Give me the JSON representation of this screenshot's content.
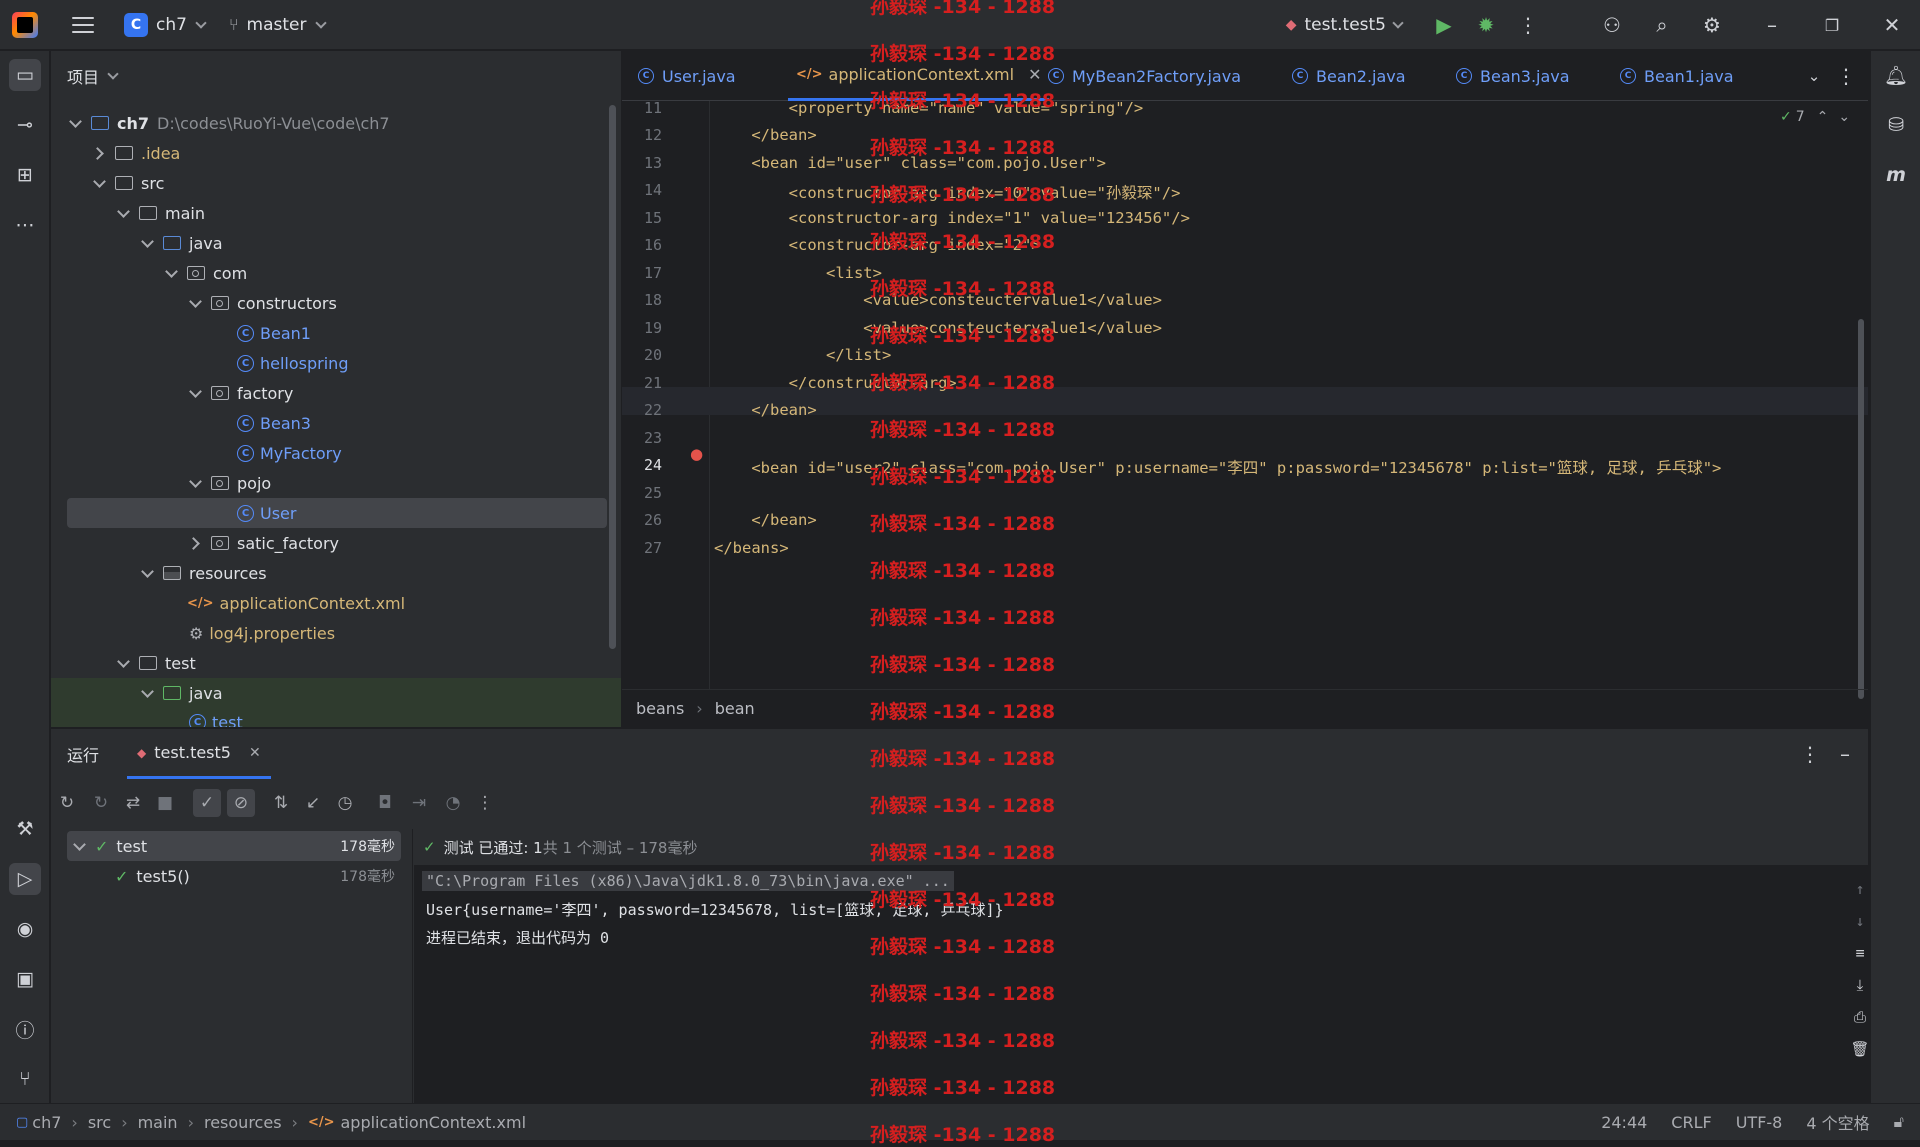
{
  "titlebar": {
    "project_name": "ch7",
    "project_badge": "C",
    "branch": "master",
    "run_config": "test.test5"
  },
  "project_panel": {
    "title": "项目",
    "tree": [
      {
        "label": "ch7",
        "detail": "D:\\codes\\RuoYi-Vue\\code\\ch7"
      },
      {
        "label": ".idea"
      },
      {
        "label": "src"
      },
      {
        "label": "main"
      },
      {
        "label": "java"
      },
      {
        "label": "com"
      },
      {
        "label": "constructors"
      },
      {
        "label": "Bean1"
      },
      {
        "label": "hellospring"
      },
      {
        "label": "factory"
      },
      {
        "label": "Bean3"
      },
      {
        "label": "MyFactory"
      },
      {
        "label": "pojo"
      },
      {
        "label": "User"
      },
      {
        "label": "satic_factory"
      },
      {
        "label": "resources"
      },
      {
        "label": "applicationContext.xml"
      },
      {
        "label": "log4j.properties"
      },
      {
        "label": "test"
      },
      {
        "label": "java"
      },
      {
        "label": "test"
      }
    ]
  },
  "editor": {
    "tabs": [
      {
        "label": "User.java"
      },
      {
        "label": "applicationContext.xml"
      },
      {
        "label": "MyBean2Factory.java"
      },
      {
        "label": "Bean2.java"
      },
      {
        "label": "Bean3.java"
      },
      {
        "label": "Bean1.java"
      }
    ],
    "inspection_count": "7",
    "line_numbers": [
      "11",
      "12",
      "13",
      "14",
      "15",
      "16",
      "17",
      "18",
      "19",
      "20",
      "21",
      "22",
      "23",
      "24",
      "25",
      "26",
      "27"
    ],
    "lines": [
      "        <property name=\"name\" value=\"spring\"/>",
      "    </bean>",
      "    <bean id=\"user\" class=\"com.pojo.User\">",
      "        <constructor-arg index=\"0\" value=\"孙毅琛\"/>",
      "        <constructor-arg index=\"1\" value=\"123456\"/>",
      "        <constructor-arg index=\"2\">",
      "            <list>",
      "                <value>consteuctervalue1</value>",
      "                <value>consteuctervalue1</value>",
      "            </list>",
      "        </constructor-arg>",
      "    </bean>",
      "",
      "    <bean id=\"user2\" class=\"com.pojo.User\" p:username=\"李四\" p:password=\"12345678\" p:list=\"篮球, 足球, 乒乓球\">",
      "",
      "    </bean>",
      "</beans>"
    ],
    "breadcrumb": [
      "beans",
      "bean"
    ]
  },
  "run_panel": {
    "title": "运行",
    "tab": "test.test5",
    "tests": [
      {
        "name": "test",
        "time": "178毫秒"
      },
      {
        "name": "test5()",
        "time": "178毫秒"
      }
    ],
    "result": "测试 已通过: 1",
    "result_detail": "共 1 个测试 – 178毫秒",
    "console": [
      "\"C:\\Program Files (x86)\\Java\\jdk1.8.0_73\\bin\\java.exe\" ...",
      "User{username='李四', password=12345678, list=[篮球, 足球, 乒乓球]}",
      "进程已结束，退出代码为 0"
    ]
  },
  "statusbar": {
    "path": [
      "ch7",
      "src",
      "main",
      "resources",
      "applicationContext.xml"
    ],
    "position": "24:44",
    "line_sep": "CRLF",
    "encoding": "UTF-8",
    "indent": "4 个空格"
  },
  "watermark": "孙毅琛 -134 - 1288",
  "colors": {
    "accent": "#3574f0",
    "watermark": "#d61f1f",
    "success": "#5fb865"
  }
}
